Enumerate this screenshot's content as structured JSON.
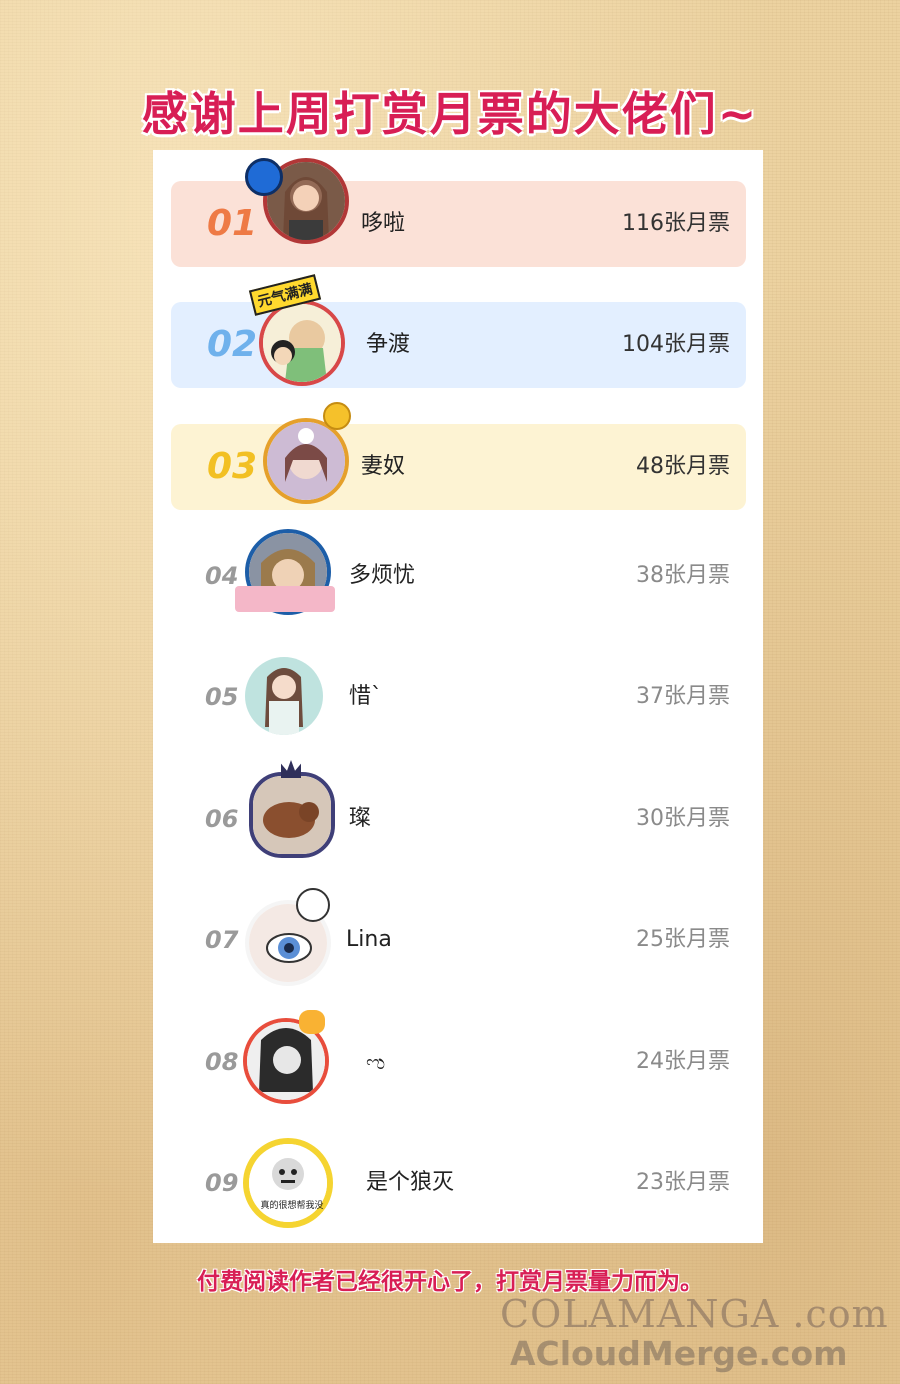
{
  "title": "感谢上周打赏月票的大佬们~",
  "rows": [
    {
      "rank": "01",
      "name": "哆啦",
      "votes": "116张月票",
      "bg": "#fbe1d7",
      "rank_color": "#ee7a45"
    },
    {
      "rank": "02",
      "name": "争渡",
      "votes": "104张月票",
      "bg": "#e3efff",
      "rank_color": "#6fb1ec"
    },
    {
      "rank": "03",
      "name": "妻奴",
      "votes": "48张月票",
      "bg": "#fdf3d3",
      "rank_color": "#f2c023"
    },
    {
      "rank": "04",
      "name": "多烦忧",
      "votes": "38张月票"
    },
    {
      "rank": "05",
      "name": "惜`",
      "votes": "37张月票"
    },
    {
      "rank": "06",
      "name": "璨",
      "votes": "30张月票"
    },
    {
      "rank": "07",
      "name": "Lina",
      "votes": "25张月票"
    },
    {
      "rank": "08",
      "name": "ಌ",
      "votes": "24张月票"
    },
    {
      "rank": "09",
      "name": "是个狼灭",
      "votes": "23张月票"
    }
  ],
  "frames": {
    "r2_badge": "元气满满",
    "r9_caption": "真的很想帮我没"
  },
  "footer": "付费阅读作者已经很开心了，打赏月票量力而为。",
  "watermark": {
    "line1": "COLAMANGA .com",
    "line2": "ACloudMerge.com"
  }
}
